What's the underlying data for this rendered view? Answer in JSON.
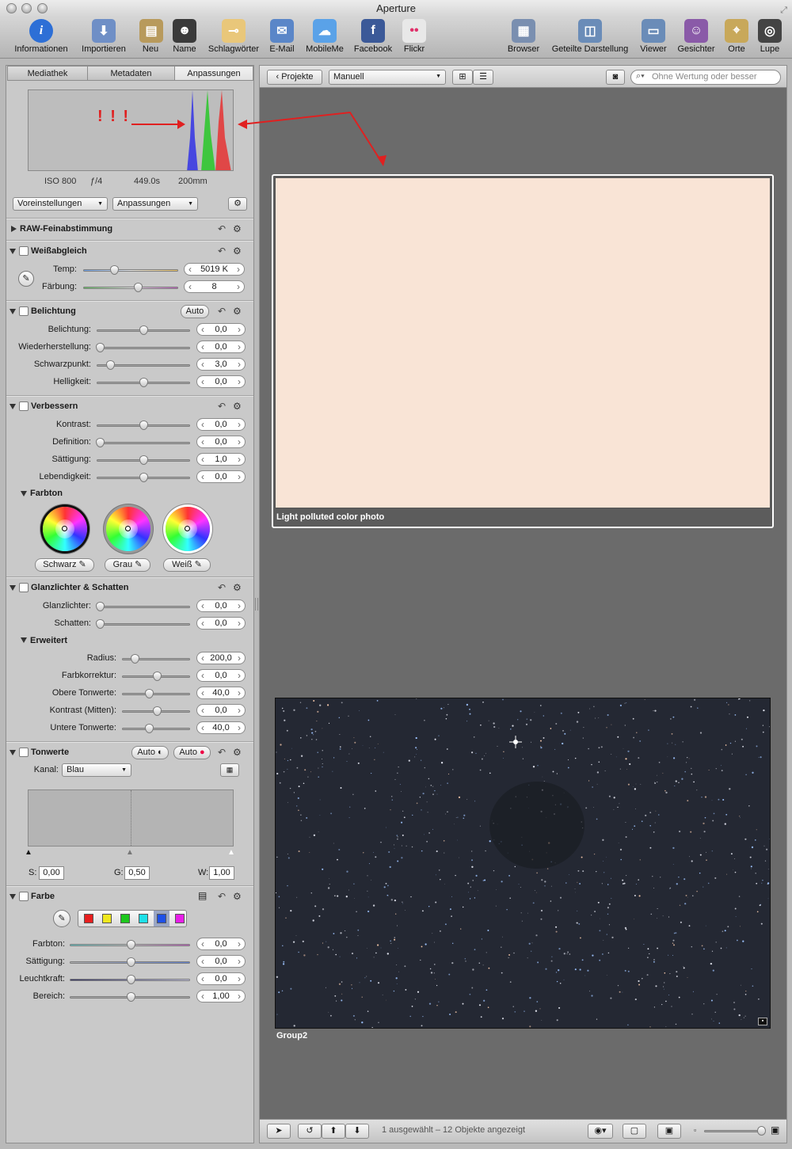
{
  "window": {
    "title": "Aperture"
  },
  "toolbar": {
    "items": [
      {
        "label": "Informationen",
        "icon": "info-icon",
        "color": "#2d6fd6"
      },
      {
        "label": "Importieren",
        "icon": "import-arrow-icon",
        "color": "#6f8fc6"
      },
      {
        "label": "Neu",
        "icon": "new-folder-icon",
        "color": "#b89a5c"
      },
      {
        "label": "Name",
        "icon": "name-person-icon",
        "color": "#3a3a3a"
      },
      {
        "label": "Schlagwörter",
        "icon": "keyword-tag-icon",
        "color": "#e9c77a"
      },
      {
        "label": "E-Mail",
        "icon": "email-stamp-icon",
        "color": "#5a86c8"
      },
      {
        "label": "MobileMe",
        "icon": "mobileme-cloud-icon",
        "color": "#5aa2e8"
      },
      {
        "label": "Facebook",
        "icon": "facebook-icon",
        "color": "#3b5998"
      },
      {
        "label": "Flickr",
        "icon": "flickr-icon",
        "color": "#e8e8e8"
      },
      {
        "label": "Browser",
        "icon": "browser-grid-icon",
        "color": "#7a8fb0"
      },
      {
        "label": "Geteilte Darstellung",
        "icon": "split-view-icon",
        "color": "#6a8cb8"
      },
      {
        "label": "Viewer",
        "icon": "viewer-icon",
        "color": "#6a8cb8"
      },
      {
        "label": "Gesichter",
        "icon": "faces-icon",
        "color": "#8a5aa8"
      },
      {
        "label": "Orte",
        "icon": "places-map-icon",
        "color": "#c8a85a"
      },
      {
        "label": "Lupe",
        "icon": "loupe-icon",
        "color": "#444444"
      }
    ]
  },
  "left": {
    "tabs": [
      "Mediathek",
      "Metadaten",
      "Anpassungen"
    ],
    "exif": {
      "iso": "ISO 800",
      "aperture": "ƒ/4",
      "shutter": "449.0s",
      "focal": "200mm"
    },
    "annotation": "! ! !",
    "presets_label": "Voreinstellungen",
    "adjustments_label": "Anpassungen",
    "raw": {
      "title": "RAW-Feinabstimmung"
    },
    "wb": {
      "title": "Weißabgleich",
      "temp_label": "Temp:",
      "temp_value": "5019 K",
      "tint_label": "Färbung:",
      "tint_value": "8"
    },
    "exposure": {
      "title": "Belichtung",
      "auto": "Auto",
      "rows": [
        {
          "label": "Belichtung:",
          "value": "0,0"
        },
        {
          "label": "Wiederherstellung:",
          "value": "0,0"
        },
        {
          "label": "Schwarzpunkt:",
          "value": "3,0"
        },
        {
          "label": "Helligkeit:",
          "value": "0,0"
        }
      ]
    },
    "enhance": {
      "title": "Verbessern",
      "rows": [
        {
          "label": "Kontrast:",
          "value": "0,0"
        },
        {
          "label": "Definition:",
          "value": "0,0"
        },
        {
          "label": "Sättigung:",
          "value": "1,0"
        },
        {
          "label": "Lebendigkeit:",
          "value": "0,0"
        }
      ],
      "tone_title": "Farbton",
      "wheels": [
        "Schwarz",
        "Grau",
        "Weiß"
      ]
    },
    "highlights": {
      "title": "Glanzlichter & Schatten",
      "rows": [
        {
          "label": "Glanzlichter:",
          "value": "0,0"
        },
        {
          "label": "Schatten:",
          "value": "0,0"
        }
      ],
      "advanced_title": "Erweitert",
      "adv_rows": [
        {
          "label": "Radius:",
          "value": "200,0"
        },
        {
          "label": "Farbkorrektur:",
          "value": "0,0"
        },
        {
          "label": "Obere Tonwerte:",
          "value": "40,0"
        },
        {
          "label": "Kontrast (Mitten):",
          "value": "0,0"
        },
        {
          "label": "Untere Tonwerte:",
          "value": "40,0"
        }
      ]
    },
    "levels": {
      "title": "Tonwerte",
      "auto1": "Auto",
      "auto2": "Auto",
      "channel_label": "Kanal:",
      "channel_value": "Blau",
      "s_label": "S:",
      "s_value": "0,00",
      "g_label": "G:",
      "g_value": "0,50",
      "w_label": "W:",
      "w_value": "1,00"
    },
    "color": {
      "title": "Farbe",
      "swatches": [
        "#e81e1e",
        "#f0e81e",
        "#1ec81e",
        "#1ee0e8",
        "#1e50e8",
        "#e81ee8"
      ],
      "rows": [
        {
          "label": "Farbton:",
          "value": "0,0"
        },
        {
          "label": "Sättigung:",
          "value": "0,0"
        },
        {
          "label": "Leuchtkraft:",
          "value": "0,0"
        },
        {
          "label": "Bereich:",
          "value": "1,00"
        }
      ]
    }
  },
  "right": {
    "projects_label": "Projekte",
    "sort_value": "Manuell",
    "search_placeholder": "Ohne Wertung oder besser",
    "photo1_caption": "Light polluted color photo",
    "photo2_caption": "Group2",
    "status": "1 ausgewählt – 12 Objekte angezeigt"
  }
}
